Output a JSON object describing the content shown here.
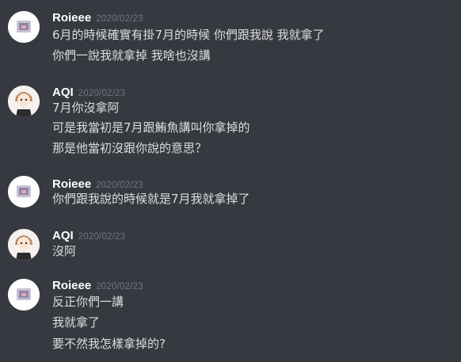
{
  "groups": [
    {
      "author": "Roieee",
      "timestamp": "2020/02/23",
      "avatar_icon": "roieee-avatar-icon",
      "lines": [
        "6月的時候確實有掛7月的時候 你們跟我說 我就拿了",
        "你們一說我就拿掉 我啥也沒講"
      ]
    },
    {
      "author": "AQI",
      "timestamp": "2020/02/23",
      "avatar_icon": "aqi-avatar-icon",
      "lines": [
        "7月你沒拿阿",
        "可是我當初是7月跟鮪魚講叫你拿掉的",
        "那是他當初沒跟你說的意思？"
      ]
    },
    {
      "author": "Roieee",
      "timestamp": "2020/02/23",
      "avatar_icon": "roieee-avatar-icon",
      "lines": [
        "你們跟我說的時候就是7月我就拿掉了"
      ]
    },
    {
      "author": "AQI",
      "timestamp": "2020/02/23",
      "avatar_icon": "aqi-avatar-icon",
      "lines": [
        "沒阿"
      ]
    },
    {
      "author": "Roieee",
      "timestamp": "2020/02/23",
      "avatar_icon": "roieee-avatar-icon",
      "lines": [
        "反正你們一講",
        "我就拿了",
        "要不然我怎樣拿掉的?"
      ]
    }
  ],
  "colors": {
    "background": "#36393f",
    "username": "#ffffff",
    "timestamp": "#72767d",
    "message_text": "#dcddde"
  }
}
